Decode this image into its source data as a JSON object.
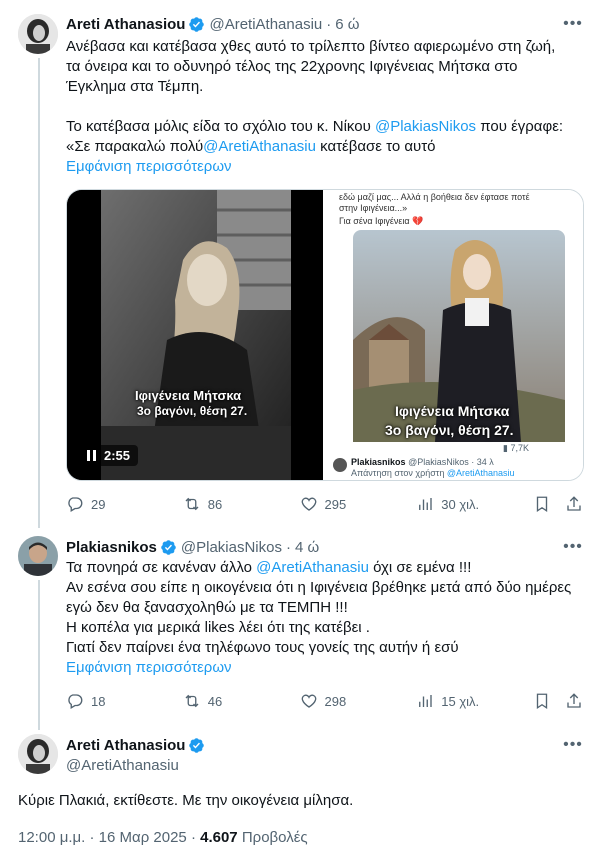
{
  "tweet1": {
    "name": "Areti Athanasiou",
    "handle": "@AretiAthanasiu",
    "time": "6 ώ",
    "lines": [
      "Ανέβασα και κατέβασα χθες αυτό το τρίλεπτο βίντεο αφιερωμένο στη ζωή,",
      "τα όνειρα και το οδυνηρό τέλος της 22χρονης Ιφιγένειας Μήτσκα στο",
      "Έγκλημα στα Τέμπη."
    ],
    "line4_pre": "Το κατέβασα μόλις είδα το σχόλιο του κ. Νίκου ",
    "line4_mention": "@PlakiasNikos",
    "line4_post": " που έγραφε:",
    "line5_pre": "«Σε παρακαλώ πολύ",
    "line5_mention": "@AretiAthanasiu",
    "line5_post": " κατέβασε το αυτό",
    "show_more": "Εμφάνιση περισσότερων",
    "video": {
      "caption_name": "Ιφιγένεια Μήτσκα",
      "caption_seat": "3ο βαγόνι, θέση 27.",
      "duration": "2:55"
    },
    "embedded": {
      "top_text_1": "εδώ μαζί μας... Αλλά η βοήθεια δεν έφτασε ποτέ",
      "top_text_2": "στην Ιφιγένεια...»",
      "top_text_3": "Για σένα Ιφιγένεια 💔",
      "caption_name": "Ιφιγένεια Μήτσκα",
      "caption_seat": "3ο βαγόνι, θέση 27.",
      "views": "7,7K",
      "reply_name": "Plakiasnikos",
      "reply_handle": "@PlakiasNikos · 34 λ",
      "reply_to_pre": "Απάντηση στον χρήστη ",
      "reply_to_mention": "@AretiAthanasiu"
    },
    "stats": {
      "replies": "29",
      "retweets": "86",
      "likes": "295",
      "views": "30 χιλ."
    }
  },
  "tweet2": {
    "name": "Plakiasnikos",
    "handle": "@PlakiasNikos",
    "time": "4 ώ",
    "line1_pre": "Τα πονηρά σε κανέναν άλλο ",
    "line1_mention": "@AretiAthanasiu",
    "line1_post": " όχι σε εμένα !!!",
    "lines": [
      "Αν εσένα σου είπε η οικογένεια ότι η Ιφιγένεια βρέθηκε μετά από δύο ημέρες",
      "εγώ δεν θα ξανασχοληθώ με τα ΤΕΜΠΗ !!!",
      "Η κοπέλα για μερικά likes λέει ότι της κατέβει .",
      "Γιατί δεν παίρνει ένα τηλέφωνο τους γονείς της αυτήν ή εσύ"
    ],
    "show_more": "Εμφάνιση περισσότερων",
    "stats": {
      "replies": "18",
      "retweets": "46",
      "likes": "298",
      "views": "15 χιλ."
    }
  },
  "tweet3": {
    "name": "Areti Athanasiou",
    "handle": "@AretiAthanasiu",
    "text": "Κύριε Πλακιά, εκτίθεστε. Με την οικογένεια μίλησα.",
    "time": "12:00 μ.μ.",
    "date": "16 Μαρ 2025",
    "views_count": "4.607",
    "views_label": "Προβολές"
  },
  "colors": {
    "accent": "#1d9bf0",
    "secondary_text": "#536471",
    "divider": "#eff3f4",
    "verified": "#1d9bf0"
  },
  "icons": [
    "reply-icon",
    "retweet-icon",
    "like-icon",
    "views-icon",
    "bookmark-icon",
    "share-icon",
    "more-icon",
    "verified-badge-icon",
    "pause-icon"
  ]
}
